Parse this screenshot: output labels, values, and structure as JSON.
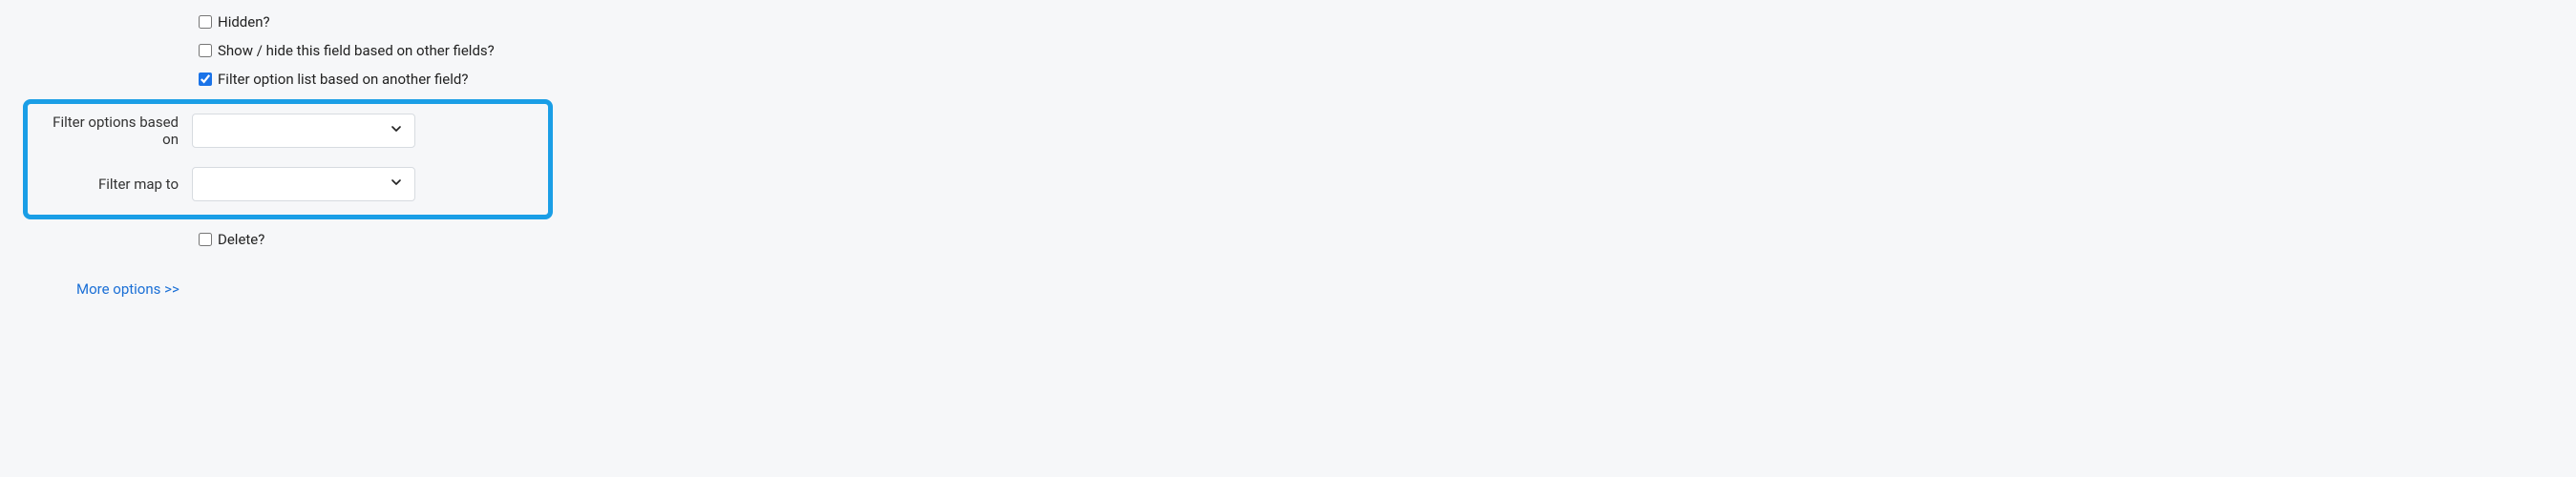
{
  "checkboxes": {
    "hidden": {
      "label": "Hidden?",
      "checked": false
    },
    "showhide": {
      "label": "Show / hide this field based on other fields?",
      "checked": false
    },
    "filter": {
      "label": "Filter option list based on another field?",
      "checked": true
    },
    "delete": {
      "label": "Delete?",
      "checked": false
    }
  },
  "selects": {
    "filter_based_on": {
      "label": "Filter options based on",
      "value": ""
    },
    "filter_map_to": {
      "label": "Filter map to",
      "value": ""
    }
  },
  "more_options": {
    "label": "More options >>"
  }
}
